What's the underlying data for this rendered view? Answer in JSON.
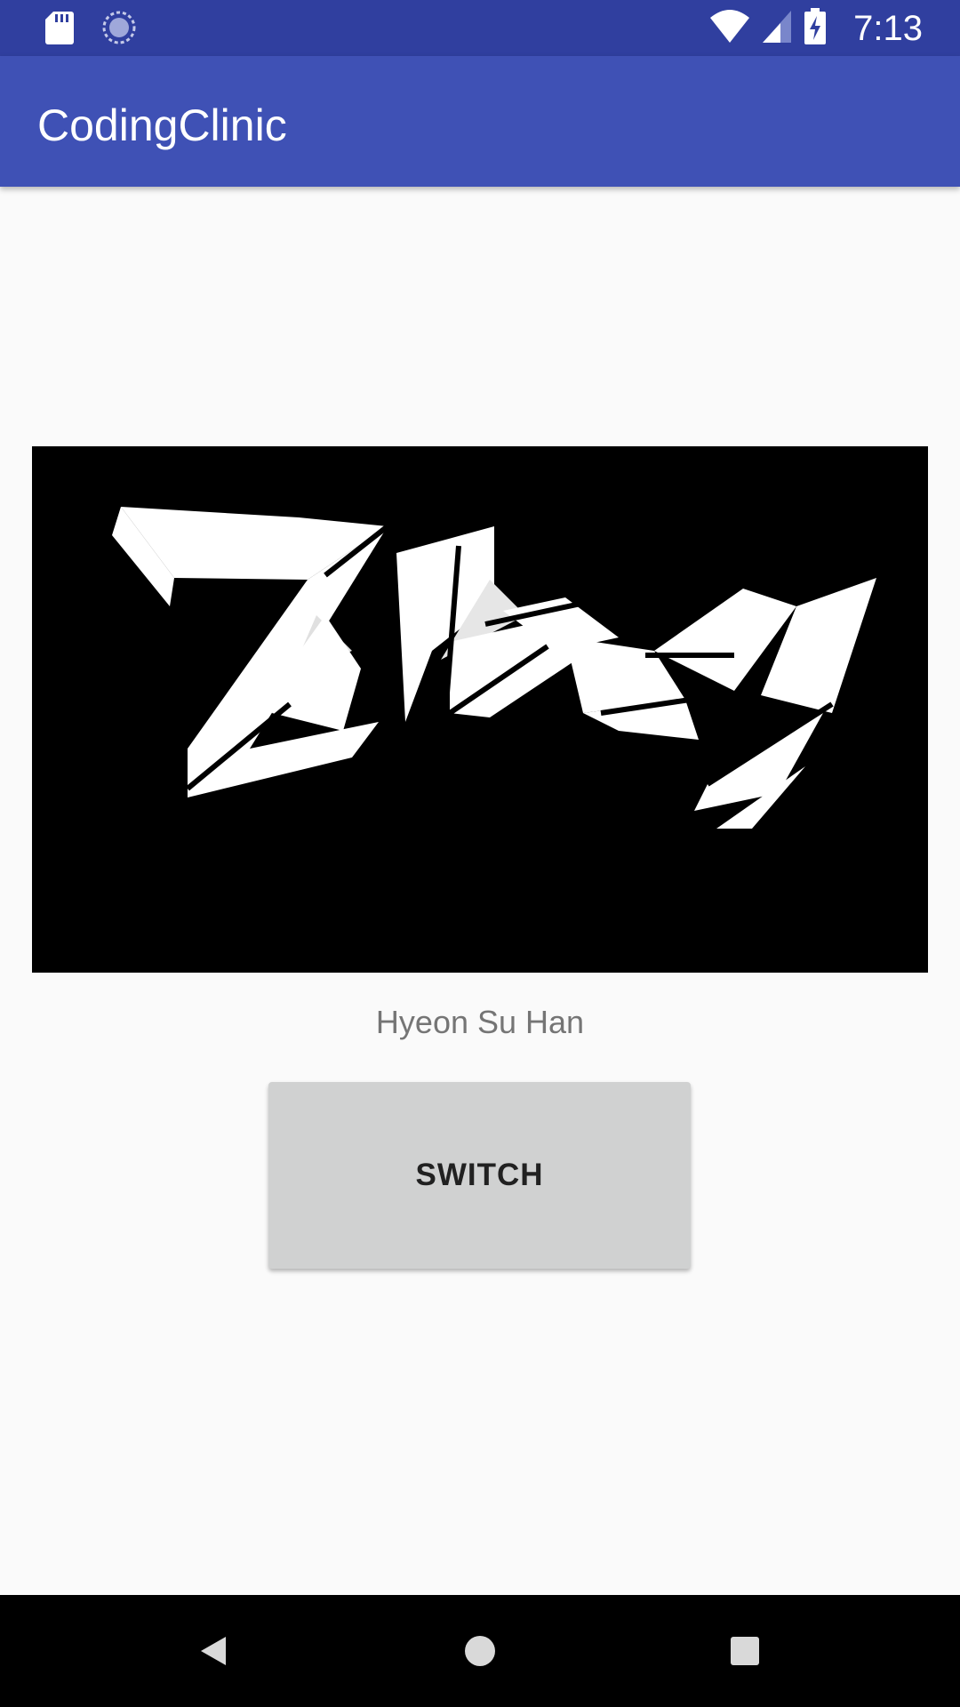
{
  "status_bar": {
    "time": "7:13",
    "icons": [
      "sd-card-icon",
      "sync-icon",
      "wifi-icon",
      "signal-icon",
      "battery-charging-icon"
    ]
  },
  "app_bar": {
    "title": "CodingClinic"
  },
  "main": {
    "image": {
      "description_icon": "zippy-logo-image",
      "background": "#000000"
    },
    "name": "Hyeon Su Han",
    "button_label": "SWITCH"
  },
  "nav_bar": {
    "icons": [
      "back-icon",
      "home-icon",
      "recents-icon"
    ]
  },
  "colors": {
    "status_bar": "#303f9f",
    "app_bar": "#3f51b5",
    "background": "#fafafa",
    "button": "#d0d1d1"
  }
}
